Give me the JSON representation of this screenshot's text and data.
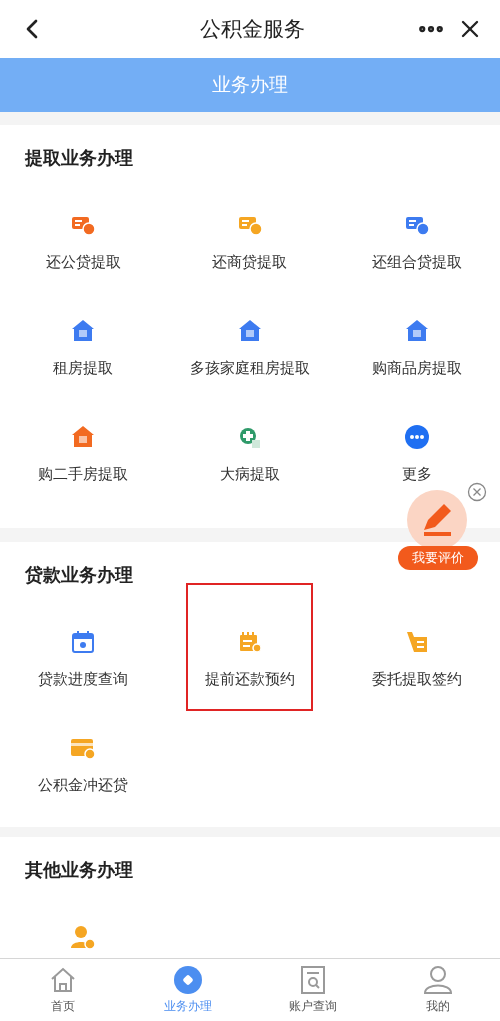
{
  "header": {
    "title": "公积金服务"
  },
  "banner": {
    "title": "业务办理"
  },
  "sections": [
    {
      "title": "提取业务办理",
      "items": [
        {
          "label": "还公贷提取",
          "kind": "card",
          "color": "#f26a21",
          "highlighted": false
        },
        {
          "label": "还商贷提取",
          "kind": "card",
          "color": "#f5a623",
          "highlighted": false
        },
        {
          "label": "还组合贷提取",
          "kind": "card",
          "color": "#3d7bf0",
          "highlighted": false
        },
        {
          "label": "租房提取",
          "kind": "house",
          "color": "#3d7bf0",
          "highlighted": false
        },
        {
          "label": "多孩家庭租房提取",
          "kind": "house",
          "color": "#3d7bf0",
          "highlighted": false
        },
        {
          "label": "购商品房提取",
          "kind": "house",
          "color": "#3d7bf0",
          "highlighted": false
        },
        {
          "label": "购二手房提取",
          "kind": "house",
          "color": "#f26a21",
          "highlighted": false
        },
        {
          "label": "大病提取",
          "kind": "medical",
          "color": "#2f9a6a",
          "highlighted": false
        },
        {
          "label": "更多",
          "kind": "more",
          "color": "#1f6ff2",
          "highlighted": false
        }
      ]
    },
    {
      "title": "贷款业务办理",
      "items": [
        {
          "label": "贷款进度查询",
          "kind": "calendar",
          "color": "#3d7bf0",
          "highlighted": false
        },
        {
          "label": "提前还款预约",
          "kind": "document",
          "color": "#f5a623",
          "highlighted": true
        },
        {
          "label": "委托提取签约",
          "kind": "cart",
          "color": "#f5a623",
          "highlighted": false
        },
        {
          "label": "公积金冲还贷",
          "kind": "wallet",
          "color": "#f5a623",
          "highlighted": false
        }
      ]
    },
    {
      "title": "其他业务办理",
      "items": [
        {
          "kind": "person",
          "color": "#f5a623",
          "highlighted": false
        }
      ]
    }
  ],
  "feedback": {
    "label": "我要评价"
  },
  "tabs": [
    {
      "label": "首页",
      "kind": "home",
      "selected": false
    },
    {
      "label": "业务办理",
      "kind": "business",
      "selected": true
    },
    {
      "label": "账户查询",
      "kind": "account",
      "selected": false
    },
    {
      "label": "我的",
      "kind": "me",
      "selected": false
    }
  ]
}
